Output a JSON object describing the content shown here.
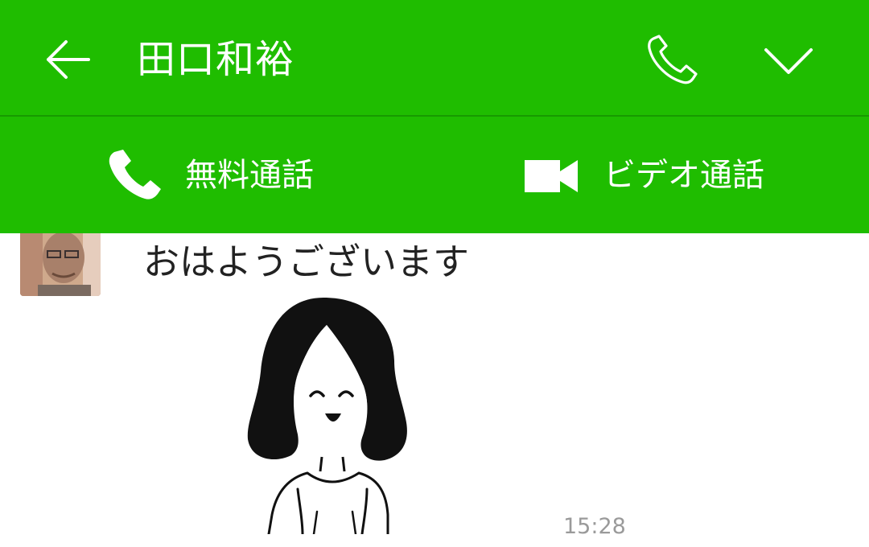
{
  "header": {
    "title": "田口和裕",
    "back_icon": "arrow-left-icon",
    "call_icon": "phone-icon",
    "menu_icon": "chevron-down-icon",
    "background_color": "#1fbd00"
  },
  "call_bar": {
    "free_call_label": "無料通話",
    "free_call_icon": "phone-filled-icon",
    "video_call_label": "ビデオ通話",
    "video_call_icon": "video-camera-icon"
  },
  "chat": {
    "messages": [
      {
        "text": "おはようございます",
        "sticker": "waving-woman-sticker",
        "time": "15:28"
      }
    ]
  }
}
